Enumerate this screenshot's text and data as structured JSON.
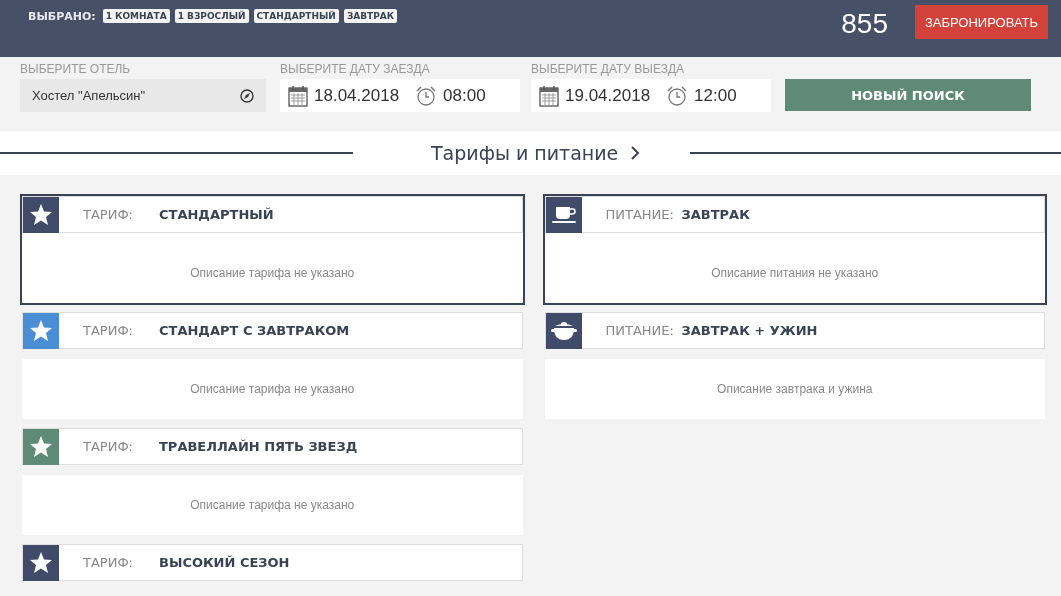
{
  "top_bar": {
    "selected_label": "ВЫБРАНО:",
    "tags": [
      "1 КОМНАТА",
      "1 ВЗРОСЛЫЙ",
      "СТАНДАРТНЫЙ",
      "ЗАВТРАК"
    ],
    "price": "855",
    "book_button": "ЗАБРОНИРОВАТЬ"
  },
  "search": {
    "hotel": {
      "label": "ВЫБЕРИТЕ ОТЕЛЬ",
      "value": "Хостел \"Апельсин\""
    },
    "checkin": {
      "label": "ВЫБЕРИТЕ ДАТУ ЗАЕЗДА",
      "date": "18.04.2018",
      "time": "08:00"
    },
    "checkout": {
      "label": "ВЫБЕРИТЕ ДАТУ ВЫЕЗДА",
      "date": "19.04.2018",
      "time": "12:00"
    },
    "search_button": "НОВЫЙ ПОИСК"
  },
  "section": {
    "title": "Тарифы и питание"
  },
  "tariffs": [
    {
      "kind": "star",
      "color": "#3f4b68",
      "label": "ТАРИФ:",
      "name": "СТАНДАРТНЫЙ",
      "description": "Описание тарифа не указано",
      "selected": true
    },
    {
      "kind": "star",
      "color": "#4a8ed6",
      "label": "ТАРИФ:",
      "name": "СТАНДАРТ С ЗАВТРАКОМ",
      "description": "Описание тарифа не указано",
      "selected": false
    },
    {
      "kind": "star",
      "color": "#5e8a78",
      "label": "ТАРИФ:",
      "name": "ТРАВЕЛЛАЙН ПЯТЬ ЗВЕЗД",
      "description": "Описание тарифа не указано",
      "selected": false
    },
    {
      "kind": "star",
      "color": "#3f4b68",
      "label": "ТАРИФ:",
      "name": "ВЫСОКИЙ СЕЗОН",
      "selected": false
    }
  ],
  "meals": [
    {
      "kind": "cup",
      "color": "#3f4b68",
      "label": "ПИТАНИЕ:",
      "name": "ЗАВТРАК",
      "description": "Описание питания не указано",
      "selected": true
    },
    {
      "kind": "pot",
      "color": "#3f4b68",
      "label": "ПИТАНИЕ:",
      "name": "ЗАВТРАК + УЖИН",
      "description": "Описание завтрака и ужина",
      "selected": false
    }
  ]
}
